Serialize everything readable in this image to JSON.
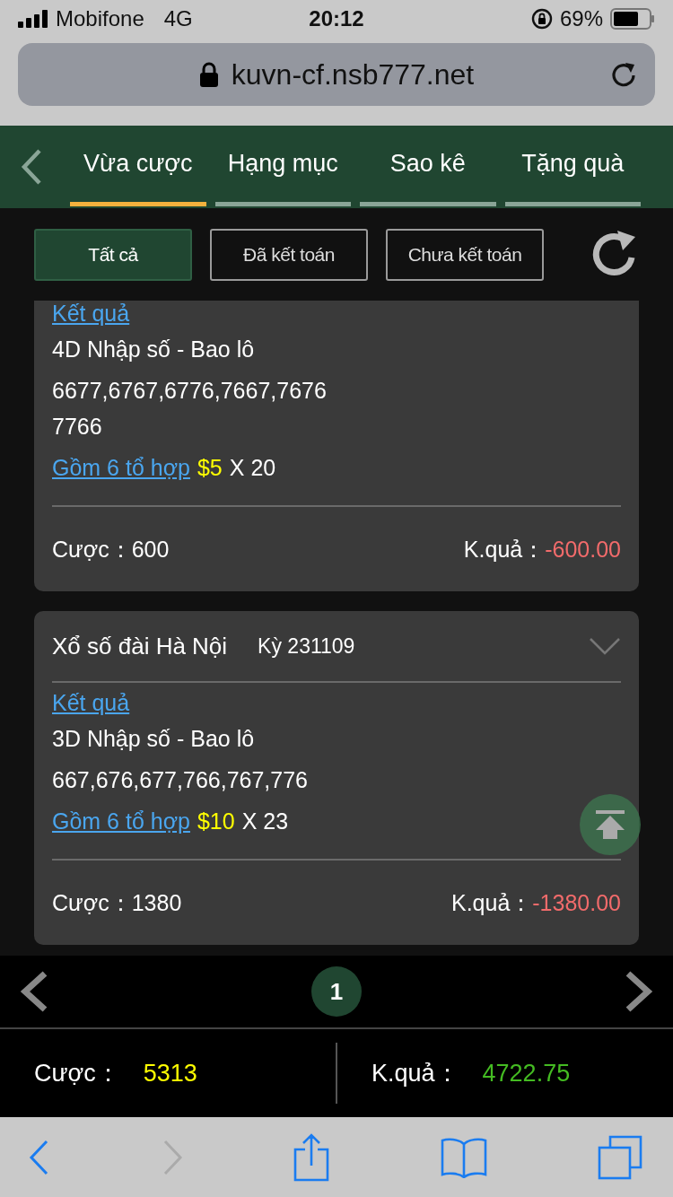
{
  "status_bar": {
    "carrier": "Mobifone",
    "network": "4G",
    "time": "20:12",
    "battery": "69%"
  },
  "browser": {
    "url": "kuvn-cf.nsb777.net"
  },
  "tabs": [
    {
      "label": "Vừa cược",
      "selected": true
    },
    {
      "label": "Hạng mục",
      "selected": false
    },
    {
      "label": "Sao kê",
      "selected": false
    },
    {
      "label": "Tặng quà",
      "selected": false
    }
  ],
  "filters": [
    {
      "label": "Tất cả",
      "selected": true
    },
    {
      "label": "Đã kết toán",
      "selected": false
    },
    {
      "label": "Chưa kết toán",
      "selected": false
    }
  ],
  "bets": [
    {
      "result_link": "Kết quả",
      "bet_type": "4D Nhập số - Bao lô",
      "numbers": [
        "6677,6767,6776,7667,7676",
        "7766"
      ],
      "combo_link": "Gồm 6 tổ hợp",
      "unit": "$5",
      "multiplier": "X 20",
      "stake_label": "Cược：",
      "stake": "600",
      "result_label": "K.quả：",
      "result": "-600.00"
    },
    {
      "title": "Xổ số đài Hà Nội",
      "period": "Kỳ 231109",
      "expanded": false,
      "result_link": "Kết quả",
      "bet_type": "3D Nhập số - Bao lô",
      "numbers": [
        "667,676,677,766,767,776"
      ],
      "combo_link": "Gồm 6 tổ hợp",
      "unit": "$10",
      "multiplier": "X 23",
      "stake_label": "Cược：",
      "stake": "1380",
      "result_label": "K.quả：",
      "result": "-1380.00"
    }
  ],
  "pagination": {
    "pages": [
      {
        "label": "1",
        "selected": true
      }
    ]
  },
  "totals": [
    {
      "label": "Cược：",
      "value": "5313",
      "color": "#ffff00"
    },
    {
      "label": "K.quả：",
      "value": "4722.75",
      "color": "#44bb22"
    }
  ]
}
